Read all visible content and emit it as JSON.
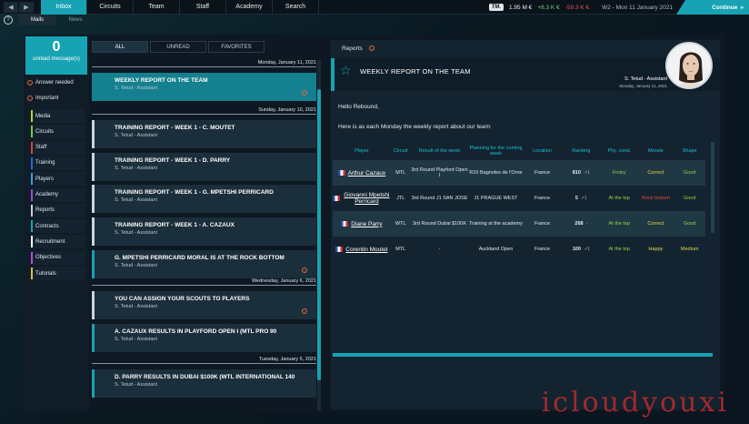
{
  "topbar": {
    "back_icon": "chevron-left-icon",
    "forward_icon": "chevron-right-icon",
    "menu": [
      "Inbox",
      "Circuits",
      "Team",
      "Staff",
      "Academy",
      "Search"
    ],
    "active_menu": "Inbox",
    "tm_logo": "TM.",
    "balance": "1.95 M €",
    "gain": "+8.3 K €",
    "loss": "-59.3 K €",
    "date": "W2 - Mon 11 January 2021",
    "continue_label": "Continue",
    "continue_icon": "chevron-double-right-icon",
    "colors": {
      "accent": "#17a3b3",
      "gain": "#6cd27c",
      "loss": "#e8504a"
    }
  },
  "subbar": {
    "help": "?",
    "tabs": [
      "Mails",
      "News"
    ],
    "active_tab": "Mails"
  },
  "sidebar": {
    "unread_count": "0",
    "unread_label": "unread message(s)",
    "filters": [
      "Answer needed",
      "Important"
    ],
    "categories": [
      {
        "label": "Media",
        "color": "#b8d23a"
      },
      {
        "label": "Circuits",
        "color": "#7cc84a"
      },
      {
        "label": "Staff",
        "color": "#d24444"
      },
      {
        "label": "Training",
        "color": "#2a62d6"
      },
      {
        "label": "Players",
        "color": "#3a9ee0"
      },
      {
        "label": "Academy",
        "color": "#9a4ad6"
      },
      {
        "label": "Reports",
        "color": "#c8d3da"
      },
      {
        "label": "Contracts",
        "color": "#17a3b3"
      },
      {
        "label": "Recruitment",
        "color": "#ffffff"
      },
      {
        "label": "Objectives",
        "color": "#b34ad6"
      },
      {
        "label": "Tutorials",
        "color": "#e0c03a"
      }
    ]
  },
  "list": {
    "tabs": [
      "ALL",
      "UNREAD",
      "FAVORITES"
    ],
    "active_tab": "ALL",
    "days": [
      {
        "label": "Monday, January 11, 2021",
        "messages": [
          {
            "title": "WEEKLY REPORT ON THE TEAM",
            "from": "S. Tetud - Assistant",
            "info": "!"
          }
        ]
      },
      {
        "label": "Sunday, January 10, 2021",
        "messages": [
          {
            "title": "TRAINING REPORT - WEEK 1 - C. MOUTET",
            "from": "S. Tetud - Assistant"
          },
          {
            "title": "TRAINING REPORT - WEEK 1 - D. PARRY",
            "from": "S. Tetud - Assistant"
          },
          {
            "title": "TRAINING REPORT - WEEK 1 - G. MPETSHI PERRICARD",
            "from": "S. Tetud - Assistant"
          },
          {
            "title": "TRAINING REPORT - WEEK 1 - A. CAZAUX",
            "from": "S. Tetud - Assistant"
          },
          {
            "title": "G. MPETSHI PERRICARD MORAL IS AT THE ROCK BOTTOM",
            "from": "S. Tetud - Assistant",
            "info": "!"
          }
        ]
      },
      {
        "label": "Wednesday, January 6, 2021",
        "messages": [
          {
            "title": "YOU CAN ASSIGN YOUR SCOUTS TO PLAYERS",
            "from": "S. Tetud - Assistant",
            "info": "!"
          },
          {
            "title": "A. CAZAUX RESULTS IN PLAYFORD OPEN I (MTL PRO 90",
            "from": "S. Tetud - Assistant"
          }
        ]
      },
      {
        "label": "Tuesday, January 5, 2021",
        "messages": [
          {
            "title": "D. PARRY RESULTS IN DUBAI $100K (WTL INTERNATIONAL 140",
            "from": "S. Tetud - Assistant"
          }
        ]
      }
    ]
  },
  "reader": {
    "section_label": "Reports",
    "section_info": "!",
    "title": "WEEKLY REPORT ON THE TEAM",
    "star_icon": "star-icon",
    "sender": "S. Tetud - Assistant",
    "sender_date": "Monday, January 11, 2021",
    "greeting": "Hello Rebound,",
    "intro": "Here is as each Monday the weekly report about our team:",
    "columns": [
      "Player",
      "Circuit",
      "Result of the week",
      "Planning for the coming week",
      "Location",
      "Ranking",
      "Phy. cond.",
      "Morale",
      "Shape"
    ],
    "rows": [
      {
        "player": "Arthur Cazaux",
        "circuit": "MTL",
        "result": "3rd Round Playford Open I",
        "planning": "R10 Bagnoles de l'Orne",
        "location": "France",
        "ranking": "810",
        "rank_change": "↗1",
        "phy": "Frisky",
        "phy_color": "#8ed54a",
        "morale": "Correct",
        "morale_color": "#e7d94c",
        "shape": "Good",
        "shape_color": "#8ed54a"
      },
      {
        "player": "Giovanni Mpetshi Perricard",
        "circuit": "JTL",
        "result": "3rd Round J1 SAN JOSE",
        "planning": "J1 PRAGUE WEST",
        "location": "France",
        "ranking": "5",
        "rank_change": "↗1",
        "phy": "At the top",
        "phy_color": "#8ed54a",
        "morale": "Rock bottom",
        "morale_color": "#e04a44",
        "shape": "Good",
        "shape_color": "#8ed54a"
      },
      {
        "player": "Diane Parry",
        "circuit": "WTL",
        "result": "3rd Round Dubai $100K",
        "planning": "Training at the academy",
        "location": "France",
        "ranking": "268",
        "rank_change": "-",
        "phy": "At the top",
        "phy_color": "#8ed54a",
        "morale": "Correct",
        "morale_color": "#e7d94c",
        "shape": "Good",
        "shape_color": "#8ed54a"
      },
      {
        "player": "Corentin Moutet",
        "circuit": "MTL",
        "result": "-",
        "planning": "Auckland Open",
        "location": "France",
        "ranking": "100",
        "rank_change": "↗1",
        "phy": "At the top",
        "phy_color": "#8ed54a",
        "morale": "Happy",
        "morale_color": "#e7d94c",
        "shape": "Medium",
        "shape_color": "#e7d94c"
      }
    ]
  },
  "watermark": "icloudyouxi"
}
